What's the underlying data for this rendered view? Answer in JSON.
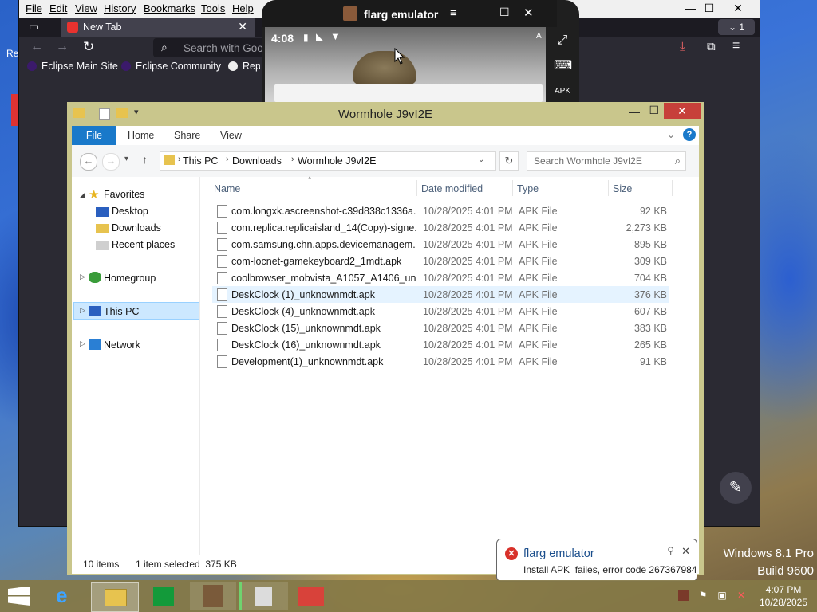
{
  "desktop": {
    "edge_text": "Re"
  },
  "browser": {
    "menu": [
      "File",
      "Edit",
      "View",
      "History",
      "Bookmarks",
      "Tools",
      "Help"
    ],
    "tab_title": "New Tab",
    "tab_count": "1",
    "url_placeholder": "Search with Goo",
    "bookmarks": [
      "Eclipse Main Site",
      "Eclipse Community",
      "Repo"
    ]
  },
  "emulator": {
    "title": "flarg emulator",
    "time": "4:08",
    "sidebar_icons": [
      "fullscreen-icon",
      "keyboard-icon",
      "install-apk-icon"
    ]
  },
  "explorer": {
    "title": "Wormhole J9vI2E",
    "ribbon": {
      "file": "File",
      "tabs": [
        "Home",
        "Share",
        "View"
      ]
    },
    "breadcrumb": [
      "This PC",
      "Downloads",
      "Wormhole J9vI2E"
    ],
    "search_placeholder": "Search Wormhole J9vI2E",
    "nav": {
      "favorites": "Favorites",
      "favorites_items": [
        "Desktop",
        "Downloads",
        "Recent places"
      ],
      "homegroup": "Homegroup",
      "this_pc": "This PC",
      "network": "Network"
    },
    "columns": {
      "name": "Name",
      "date": "Date modified",
      "type": "Type",
      "size": "Size"
    },
    "files": [
      {
        "name": "com.longxk.ascreenshot-c39d838c1336a...",
        "date": "10/28/2025 4:01 PM",
        "type": "APK File",
        "size": "92 KB"
      },
      {
        "name": "com.replica.replicaisland_14(Copy)-signe...",
        "date": "10/28/2025 4:01 PM",
        "type": "APK File",
        "size": "2,273 KB"
      },
      {
        "name": "com.samsung.chn.apps.devicemanagem...",
        "date": "10/28/2025 4:01 PM",
        "type": "APK File",
        "size": "895 KB"
      },
      {
        "name": "com-locnet-gamekeyboard2_1mdt.apk",
        "date": "10/28/2025 4:01 PM",
        "type": "APK File",
        "size": "309 KB"
      },
      {
        "name": "coolbrowser_mobvista_A1057_A1406_un...",
        "date": "10/28/2025 4:01 PM",
        "type": "APK File",
        "size": "704 KB"
      },
      {
        "name": "DeskClock (1)_unknownmdt.apk",
        "date": "10/28/2025 4:01 PM",
        "type": "APK File",
        "size": "376 KB"
      },
      {
        "name": "DeskClock (4)_unknownmdt.apk",
        "date": "10/28/2025 4:01 PM",
        "type": "APK File",
        "size": "607 KB"
      },
      {
        "name": "DeskClock (15)_unknownmdt.apk",
        "date": "10/28/2025 4:01 PM",
        "type": "APK File",
        "size": "383 KB"
      },
      {
        "name": "DeskClock (16)_unknownmdt.apk",
        "date": "10/28/2025 4:01 PM",
        "type": "APK File",
        "size": "265 KB"
      },
      {
        "name": "Development(1)_unknownmdt.apk",
        "date": "10/28/2025 4:01 PM",
        "type": "APK File",
        "size": "91 KB"
      }
    ],
    "hover_row": 5,
    "status": {
      "count": "10 items",
      "selected": "1 item selected  375 KB"
    }
  },
  "notification": {
    "title": "flarg emulator",
    "message": "Install APK  failes, error code 267367984"
  },
  "os": {
    "edition": "Windows 8.1 Pro",
    "build": "Build 9600"
  },
  "taskbar": {
    "time": "4:07 PM",
    "date": "10/28/2025"
  },
  "colors": {
    "accent_blue": "#1979ca",
    "close_red": "#c7403a",
    "selection": "#cce8ff",
    "error_red": "#d8312a"
  }
}
